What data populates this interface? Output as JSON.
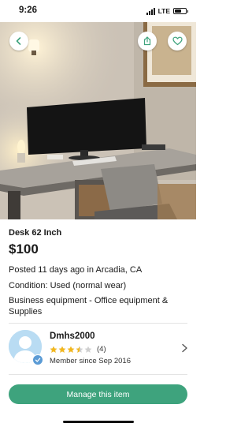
{
  "status_bar": {
    "time": "9:26",
    "network": "LTE",
    "battery_level": 0.55
  },
  "photo": {
    "icons": {
      "back": "back-chevron-icon",
      "share": "share-icon",
      "favorite": "heart-icon"
    }
  },
  "listing": {
    "title": "Desk 62 Inch",
    "price": "$100",
    "posted": "Posted 11 days ago in Arcadia, CA",
    "condition": "Condition: Used (normal wear)",
    "category": "Business equipment - Office equipment & Supplies"
  },
  "seller": {
    "name": "Dmhs2000",
    "rating": 3.5,
    "rating_count": "(4)",
    "member_since": "Member since Sep 2016",
    "star_color": "#f3b71c"
  },
  "actions": {
    "manage_label": "Manage this item",
    "manage_color": "#3ea37d"
  }
}
